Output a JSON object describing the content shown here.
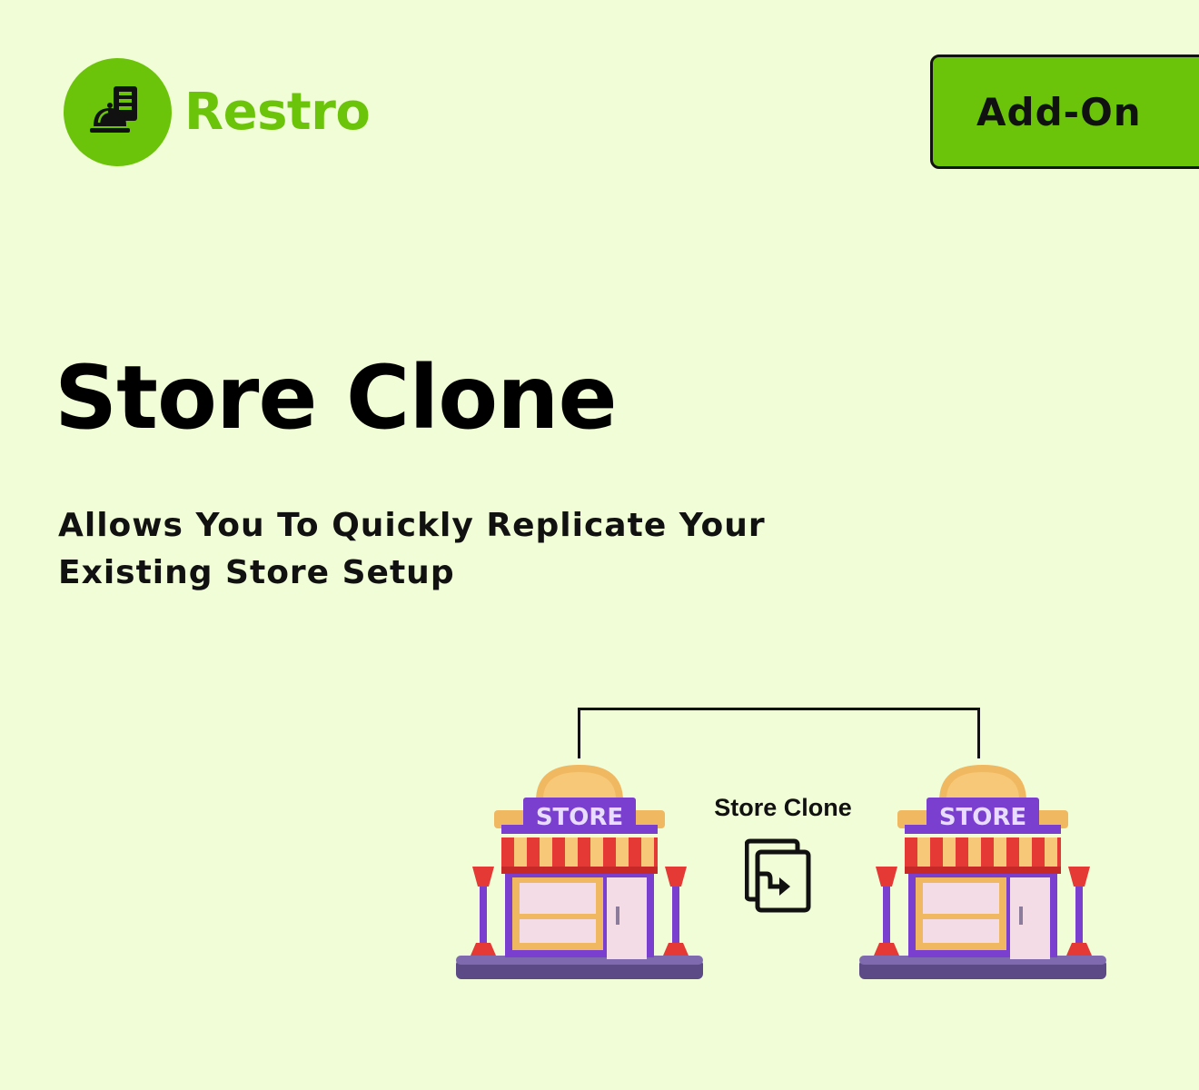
{
  "brand": {
    "name": "Restro",
    "color": "#6cc40a",
    "icon": "service-bell-icon"
  },
  "badge": {
    "label": "Add-On"
  },
  "headline": {
    "title": "Store Clone",
    "subtitle_line1": "Allows You To Quickly Replicate Your",
    "subtitle_line2": "Existing Store Setup"
  },
  "diagram": {
    "clone_label": "Store Clone",
    "clone_icon": "copy-arrow-icon",
    "store_sign": "STORE",
    "store_icon": "storefront-icon"
  },
  "colors": {
    "background": "#f0fdd6",
    "accent": "#6cc40a",
    "store_purple": "#7b3fd0",
    "awning_red": "#e53935"
  }
}
